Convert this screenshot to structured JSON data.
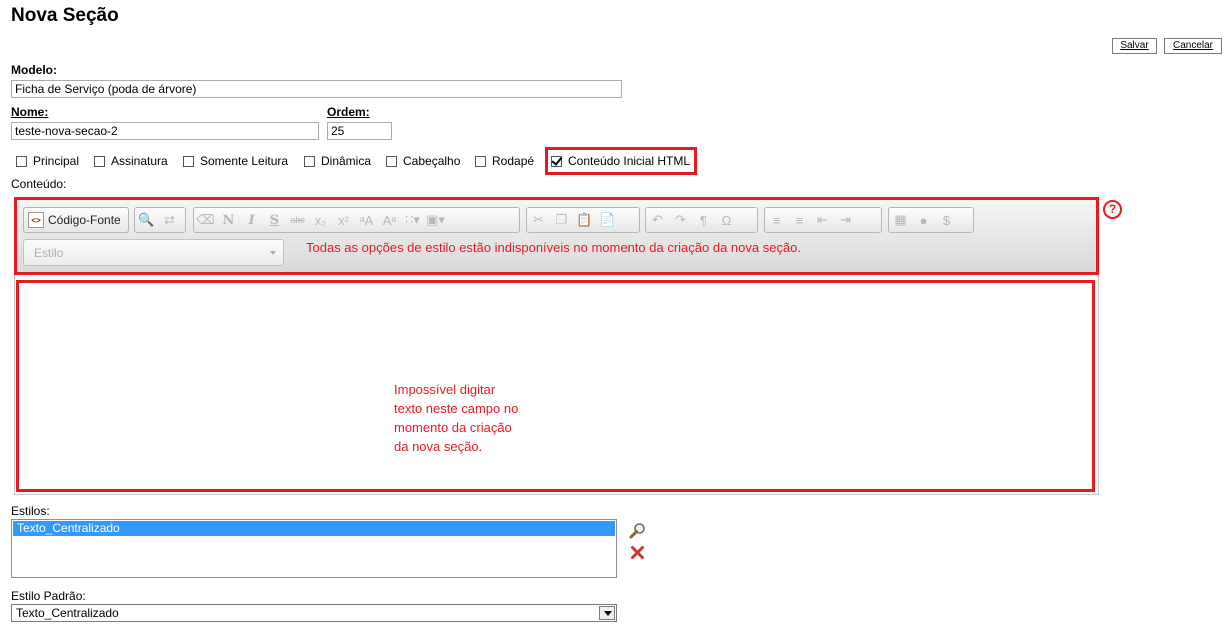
{
  "page": {
    "title": "Nova Seção"
  },
  "actions": {
    "save": "Salvar",
    "cancel": "Cancelar"
  },
  "form": {
    "modelo": {
      "label": "Modelo:",
      "value": "Ficha de Serviço (poda de árvore)"
    },
    "nome": {
      "label": "Nome:",
      "value": "teste-nova-secao-2"
    },
    "ordem": {
      "label": "Ordem:",
      "value": "25"
    },
    "checkboxes": [
      {
        "label": "Principal",
        "checked": false
      },
      {
        "label": "Assinatura",
        "checked": false
      },
      {
        "label": "Somente Leitura",
        "checked": false
      },
      {
        "label": "Dinâmica",
        "checked": false
      },
      {
        "label": "Cabeçalho",
        "checked": false
      },
      {
        "label": "Rodapé",
        "checked": false
      },
      {
        "label": "Conteúdo Inicial HTML",
        "checked": true
      }
    ],
    "conteudo_label": "Conteúdo:"
  },
  "editor": {
    "source_button": "Código-Fonte",
    "source_icon": "source-code-icon",
    "style_placeholder": "Estilo",
    "toolbar_note": "Todas as opções de estilo estão indisponíveis no momento da criação da nova seção.",
    "content_note": [
      "Impossível digitar",
      "texto neste campo no",
      "momento da criação",
      "da nova seção."
    ],
    "help_icon": "?"
  },
  "styles": {
    "label": "Estilos:",
    "items": [
      "Texto_Centralizado"
    ],
    "default_label": "Estilo Padrão:",
    "default_value": "Texto_Centralizado"
  },
  "colors": {
    "annotation_red": "#e31b23",
    "selection_blue": "#3399ff"
  }
}
